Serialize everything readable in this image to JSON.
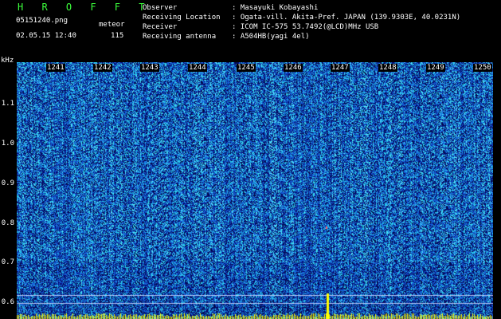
{
  "header": {
    "app_title": "H R O F F T",
    "filename": "05151240.png",
    "date_time": "02.05.15 12:40",
    "meteor_label": "meteor",
    "meteor_count": "115"
  },
  "info": {
    "observer_label": "Observer",
    "observer_value": ": Masayuki Kobayashi",
    "location_label": "Receiving Location",
    "location_value": ": Ogata-vill. Akita-Pref. JAPAN (139.9303E, 40.0231N)",
    "receiver_label": "Receiver",
    "receiver_value": ": ICOM IC-575 53.7492(@LCD)MHz USB",
    "antenna_label": "Receiving antenna",
    "antenna_value": ": A504HB(yagi 4el)"
  },
  "axis": {
    "unit": "kHz",
    "y_ticks": [
      "1.1",
      "1.0",
      "0.9",
      "0.8",
      "0.7",
      "0.6"
    ]
  },
  "minutes": [
    "1241",
    "1242",
    "1243",
    "1244",
    "1245",
    "1246",
    "1247",
    "1248",
    "1249",
    "1250"
  ],
  "colors": {
    "background": "#000000",
    "header_text": "#3cff3c",
    "noise_low": "#0a1a8c",
    "noise_mid": "#1f5fe0",
    "noise_high": "#60e0ff",
    "signal": "#ffff00"
  }
}
